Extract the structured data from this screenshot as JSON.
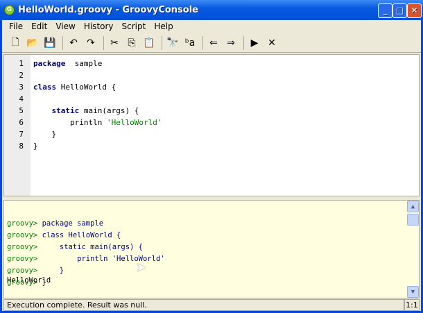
{
  "window": {
    "title": "HelloWorld.groovy - GroovyConsole",
    "icon": "G",
    "minimize": "_",
    "maximize": "□",
    "close": "✕"
  },
  "menu": [
    "File",
    "Edit",
    "View",
    "History",
    "Script",
    "Help"
  ],
  "toolbar": [
    {
      "name": "new-file-icon",
      "glyph": "🗋"
    },
    {
      "name": "open-icon",
      "glyph": "📂"
    },
    {
      "name": "save-icon",
      "glyph": "💾"
    },
    {
      "sep": true
    },
    {
      "name": "undo-icon",
      "glyph": "↶"
    },
    {
      "name": "redo-icon",
      "glyph": "↷"
    },
    {
      "sep": true
    },
    {
      "name": "cut-icon",
      "glyph": "✂"
    },
    {
      "name": "copy-icon",
      "glyph": "⎘"
    },
    {
      "name": "paste-icon",
      "glyph": "📋"
    },
    {
      "sep": true
    },
    {
      "name": "find-icon",
      "glyph": "🔭"
    },
    {
      "name": "replace-icon",
      "glyph": "ᵇa"
    },
    {
      "sep": true
    },
    {
      "name": "history-previous-icon",
      "glyph": "⇐"
    },
    {
      "name": "history-next-icon",
      "glyph": "⇒"
    },
    {
      "sep": true
    },
    {
      "name": "run-script-icon",
      "glyph": "▶"
    },
    {
      "name": "interrupt-icon",
      "glyph": "✕"
    }
  ],
  "editor": {
    "line_numbers": [
      "1",
      "2",
      "3",
      "4",
      "5",
      "6",
      "7",
      "8"
    ],
    "lines": [
      [
        [
          "kw",
          "package"
        ],
        [
          "",
          "  sample"
        ]
      ],
      [],
      [
        [
          "kw",
          "class"
        ],
        [
          "",
          " HelloWorld {"
        ]
      ],
      [],
      [
        [
          "",
          "    "
        ],
        [
          "kw",
          "static"
        ],
        [
          "",
          " main(args) {"
        ]
      ],
      [
        [
          "",
          "        println "
        ],
        [
          "str",
          "'HelloWorld'"
        ]
      ],
      [
        [
          "",
          "    }"
        ]
      ],
      [
        [
          "",
          "}"
        ]
      ]
    ]
  },
  "output": {
    "prompt": "groovy>",
    "lines": [
      " package sample",
      " class HelloWorld {",
      "     static main(args) {",
      "         println 'HelloWorld'",
      "     }",
      " }"
    ],
    "result": "HelloWorld"
  },
  "status": {
    "message": "Execution complete. Result was null.",
    "position": "1:1"
  }
}
